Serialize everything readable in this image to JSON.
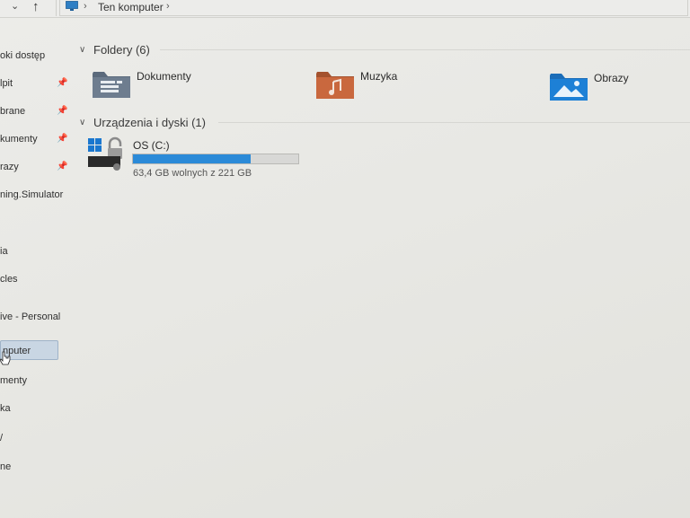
{
  "addressbar": {
    "crumb": "Ten komputer",
    "sep": "›"
  },
  "sidebar": {
    "items": [
      {
        "label": "oki dostęp",
        "pinned": false
      },
      {
        "label": "lpit",
        "pinned": true
      },
      {
        "label": "brane",
        "pinned": true
      },
      {
        "label": "kumenty",
        "pinned": true
      },
      {
        "label": "razy",
        "pinned": true
      },
      {
        "label": "ning.Simulator",
        "pinned": false
      },
      {
        "label": "ia",
        "pinned": false
      },
      {
        "label": "cles",
        "pinned": false
      },
      {
        "label": "ive - Personal",
        "pinned": false
      },
      {
        "label": "nputer",
        "pinned": false,
        "selected": true
      },
      {
        "label": "menty",
        "pinned": false
      },
      {
        "label": "ka",
        "pinned": false
      },
      {
        "label": "/",
        "pinned": false
      },
      {
        "label": "ne",
        "pinned": false
      }
    ]
  },
  "folders_section": {
    "title": "Foldery (6)",
    "items": [
      {
        "name": "Dokumenty",
        "icon": "documents-folder-icon"
      },
      {
        "name": "Muzyka",
        "icon": "music-folder-icon"
      },
      {
        "name": "Obrazy",
        "icon": "pictures-folder-icon"
      }
    ]
  },
  "drives_section": {
    "title": "Urządzenia i dyski (1)",
    "drive": {
      "name": "OS (C:)",
      "free_text": "63,4 GB wolnych z 221 GB",
      "used_fraction": 0.713,
      "bar_color": "#2b8ad8"
    }
  },
  "colors": {
    "accent": "#2b8ad8",
    "selected_bg": "#c9d6e3"
  }
}
